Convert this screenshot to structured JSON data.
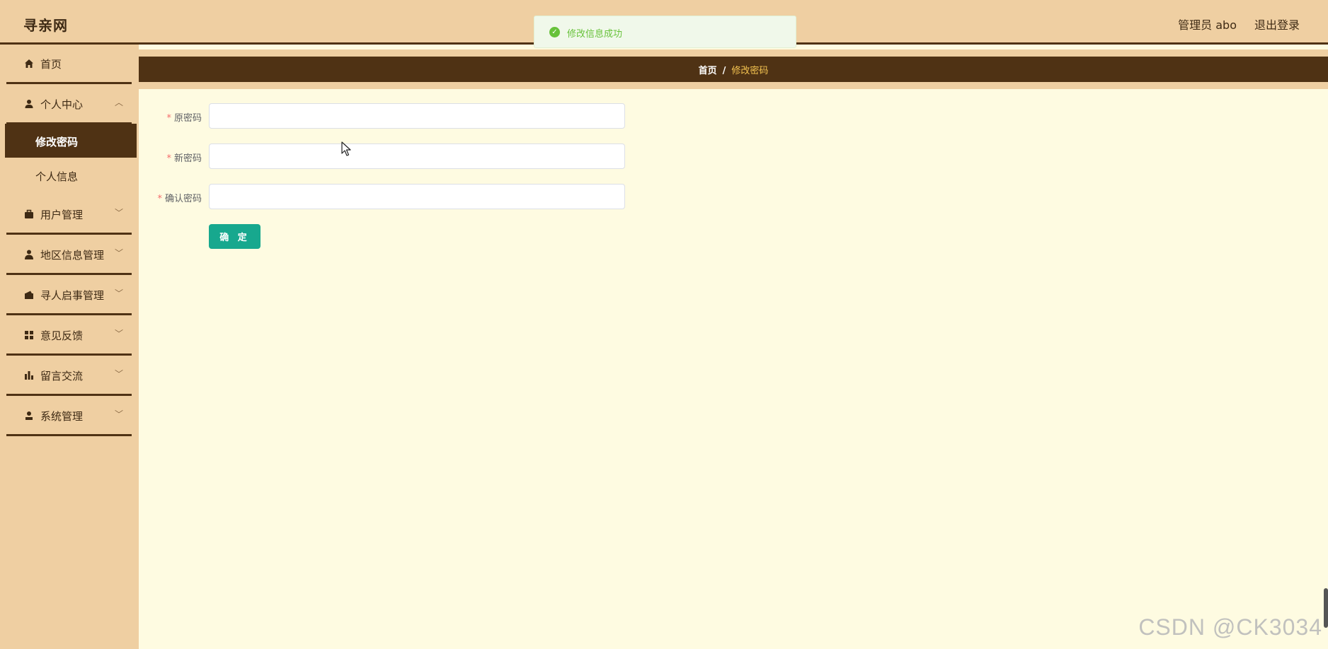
{
  "header": {
    "title": "寻亲网",
    "user_label": "管理员 abo",
    "logout_label": "退出登录"
  },
  "toast": {
    "message": "修改信息成功",
    "icon": "check-circle-icon",
    "color": "#67c23a"
  },
  "sidebar": {
    "items": [
      {
        "label": "首页",
        "icon": "home-icon"
      },
      {
        "label": "个人中心",
        "icon": "user-icon"
      },
      {
        "label": "用户管理",
        "icon": "briefcase-icon"
      },
      {
        "label": "地区信息管理",
        "icon": "person-icon"
      },
      {
        "label": "寻人启事管理",
        "icon": "wallet-icon"
      },
      {
        "label": "意见反馈",
        "icon": "grid-icon"
      },
      {
        "label": "留言交流",
        "icon": "bar-chart-icon"
      },
      {
        "label": "系统管理",
        "icon": "user-admin-icon"
      }
    ],
    "sub_items": [
      {
        "label": "修改密码",
        "active": true
      },
      {
        "label": "个人信息",
        "active": false
      }
    ]
  },
  "breadcrumb": {
    "home": "首页",
    "separator": "/",
    "current": "修改密码"
  },
  "form": {
    "old_password_label": "原密码",
    "new_password_label": "新密码",
    "confirm_password_label": "确认密码",
    "required_mark": "*",
    "old_password_value": "",
    "new_password_value": "",
    "confirm_password_value": "",
    "submit_label": "确 定"
  },
  "watermark": "CSDN @CK3034",
  "colors": {
    "header_bg": "#efcfa2",
    "accent_dark": "#4f3214",
    "content_bg": "#fefbe1",
    "submit_bg": "#17a88e",
    "breadcrumb_current": "#f5c451"
  }
}
